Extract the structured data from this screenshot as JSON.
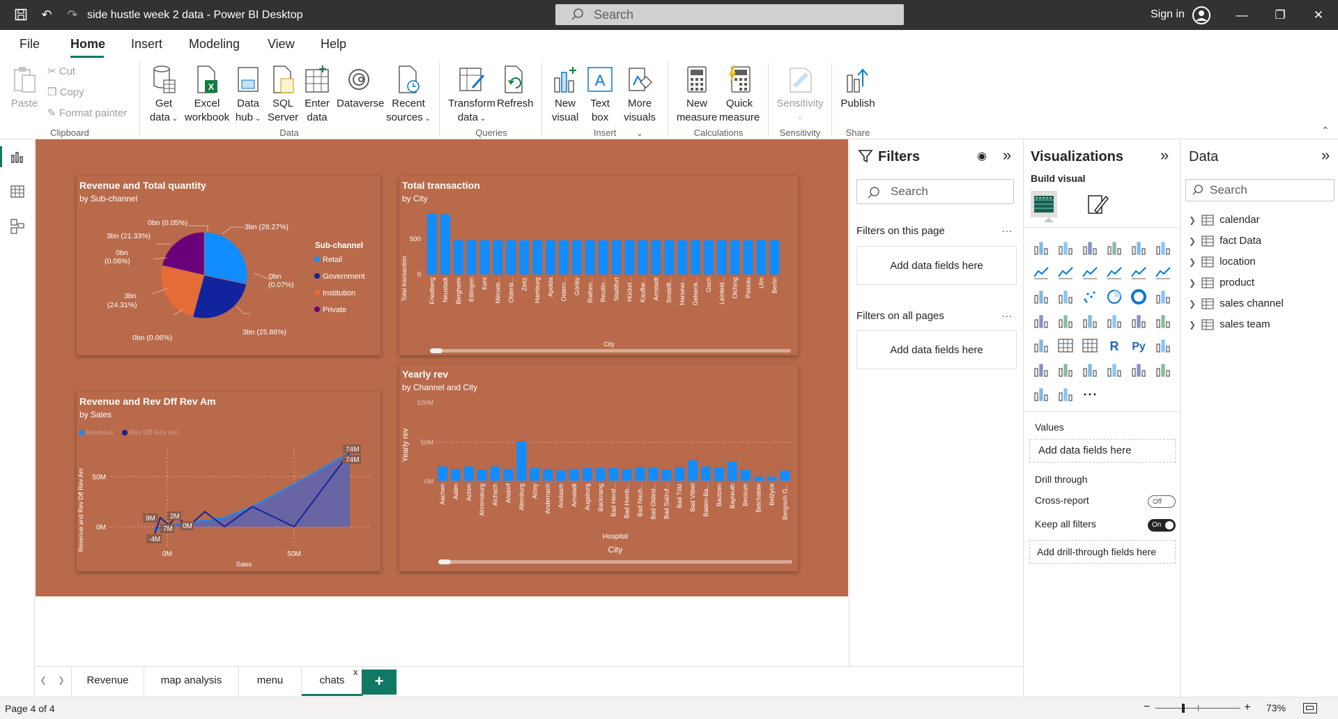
{
  "titlebar": {
    "doc_title": "side hustle week 2 data - Power BI Desktop",
    "search": "Search",
    "signin": "Sign in"
  },
  "menu": {
    "file": "File",
    "home": "Home",
    "insert": "Insert",
    "modeling": "Modeling",
    "view": "View",
    "help": "Help"
  },
  "ribbon": {
    "paste": "Paste",
    "cut": "Cut",
    "copy": "Copy",
    "format_painter": "Format painter",
    "clipboard": "Clipboard",
    "get_data_1": "Get",
    "get_data_2": "data",
    "excel_1": "Excel",
    "excel_2": "workbook",
    "hub_1": "Data",
    "hub_2": "hub",
    "sql_1": "SQL",
    "sql_2": "Server",
    "enter_1": "Enter",
    "enter_2": "data",
    "dataverse": "Dataverse",
    "recent_1": "Recent",
    "recent_2": "sources",
    "data_group": "Data",
    "transform_1": "Transform",
    "transform_2": "data",
    "refresh": "Refresh",
    "queries": "Queries",
    "newvis_1": "New",
    "newvis_2": "visual",
    "textbox_1": "Text",
    "textbox_2": "box",
    "morevis_1": "More",
    "morevis_2": "visuals",
    "insert_group": "Insert",
    "newmeasure_1": "New",
    "newmeasure_2": "measure",
    "quick_1": "Quick",
    "quick_2": "measure",
    "calc_group": "Calculations",
    "sensitivity": "Sensitivity",
    "sensitivity_group": "Sensitivity",
    "publish": "Publish",
    "share": "Share"
  },
  "pie_card": {
    "title": "Revenue and Total quantity",
    "subtitle": "by Sub-channel",
    "legend_title": "Sub-channel",
    "labels": [
      "0bn (0.05%)",
      "3bn (28.27%)",
      "3bn (21.33%)",
      "0bn",
      "(0.06%)",
      "0bn",
      "(0.07%)",
      "3bn",
      "(24.31%)",
      "0bn (0.06%)",
      "3bn (25.86%)"
    ]
  },
  "bar_card": {
    "title": "Total transaction",
    "subtitle": "by City",
    "ylabel": "Total transaction",
    "xlabel": "City",
    "ticks": [
      "500",
      "0"
    ]
  },
  "line_card": {
    "title": "Revenue and Rev Dff Rev Am",
    "subtitle": "by Sales",
    "ylabel": "Revenue and Rev Dff Rev Am",
    "xlabel": "Sales",
    "legend": [
      "Revenue",
      "Rev Dff Rev Am"
    ],
    "yticks": [
      "50M",
      "0M"
    ],
    "xticks": [
      "0M",
      "50M"
    ],
    "annot": [
      "74M",
      "74M",
      "9M",
      "2M",
      "7M",
      "0M",
      "-4M"
    ]
  },
  "yearly_card": {
    "title": "Yearly rev",
    "subtitle": "by Channel and City",
    "ylabel": "Yearly rev",
    "xlabel": "City",
    "group_label": "Hospital",
    "yticks": [
      "100M",
      "50M",
      "0M"
    ]
  },
  "chart_data": [
    {
      "type": "pie",
      "title": "Revenue and Total quantity",
      "subtitle": "by Sub-channel",
      "legend_title": "Sub-channel",
      "categories": [
        "Retail",
        "Government",
        "Institution",
        "Private"
      ],
      "values": [
        28.27,
        25.86,
        24.31,
        21.33
      ],
      "colors": [
        "#118DFF",
        "#12239E",
        "#E66C37",
        "#6B007B"
      ]
    },
    {
      "type": "bar",
      "title": "Total transaction",
      "subtitle": "by City",
      "xlabel": "City",
      "ylabel": "Total transaction",
      "ylim": [
        0,
        750
      ],
      "categories": [
        "Friedberg",
        "Neustadt",
        "Bergheim",
        "Ettlingen",
        "Kehl",
        "Merseb...",
        "Oldenb...",
        "Zeitz",
        "Hamburg",
        "Apolda",
        "Ostern...",
        "Görlitz",
        "Rathen...",
        "Reutlin...",
        "Stadtfurt",
        "Hückel...",
        "Kaufbe...",
        "Arnstadt",
        "Sindelfi...",
        "Harsewi...",
        "Gelsenk...",
        "Goch",
        "Leinfeld...",
        "Olching",
        "Passau",
        "Ulm",
        "Berlin"
      ],
      "values": [
        730,
        720,
        410,
        410,
        410,
        410,
        410,
        410,
        410,
        410,
        410,
        410,
        410,
        410,
        410,
        410,
        410,
        410,
        410,
        410,
        410,
        410,
        410,
        410,
        410,
        410,
        410
      ]
    },
    {
      "type": "line",
      "title": "Revenue and Rev Dff Rev Am",
      "subtitle": "by Sales",
      "xlabel": "Sales",
      "ylabel": "Revenue and Rev Dff Rev Am",
      "series": [
        {
          "name": "Revenue",
          "x": [
            0,
            1,
            5,
            15,
            25,
            35,
            45,
            55,
            70
          ],
          "y": [
            -4,
            -3,
            2,
            5,
            9,
            20,
            35,
            50,
            74
          ]
        },
        {
          "name": "Rev Dff Rev Am",
          "x": [
            0,
            2,
            5,
            8,
            12,
            18,
            25,
            35,
            50,
            70
          ],
          "y": [
            -7,
            9,
            2,
            10,
            0,
            15,
            0,
            20,
            0,
            74
          ]
        }
      ]
    },
    {
      "type": "bar",
      "title": "Yearly rev",
      "subtitle": "by Channel and City",
      "xlabel": "City",
      "ylabel": "Yearly rev",
      "ylim": [
        0,
        100
      ],
      "group": "Hospital",
      "categories": [
        "Aachen",
        "Aalen",
        "Achim",
        "Ahrensburg",
        "Aichach",
        "Alsdorf",
        "Altenburg",
        "Alzey",
        "Andernach",
        "Ansbach",
        "Arnstadt",
        "Augsburg",
        "Backnang",
        "Bad Hersf...",
        "Bad Homb...",
        "Bad Nauh...",
        "Bad Oldesl...",
        "Bad Salzuf...",
        "Bad Tölz",
        "Bad Vilbel",
        "Baden-Ba...",
        "Bautzen",
        "Bayreuth",
        "Beckum",
        "Belchatow",
        "Bełżyce",
        "Bergisch G..."
      ],
      "values": [
        18,
        15,
        18,
        14,
        18,
        15,
        50,
        16,
        15,
        13,
        15,
        16,
        16,
        16,
        15,
        17,
        17,
        14,
        17,
        26,
        18,
        17,
        24,
        14,
        5,
        5,
        13
      ]
    }
  ],
  "filters": {
    "title": "Filters",
    "search": "Search",
    "on_page": "Filters on this page",
    "on_all": "Filters on all pages",
    "add": "Add data fields here",
    "add2": "Add data fields here",
    "dots": "…"
  },
  "viz": {
    "title": "Visualizations",
    "build": "Build visual",
    "values": "Values",
    "add_values": "Add data fields here",
    "drill": "Drill through",
    "cross": "Cross-report",
    "cross_state": "Off",
    "keep": "Keep all filters",
    "keep_state": "On",
    "add_drill": "Add drill-through fields here"
  },
  "data": {
    "title": "Data",
    "search": "Search",
    "tables": [
      "calendar",
      "fact Data",
      "location",
      "product",
      "sales channel",
      "sales team"
    ]
  },
  "pages": {
    "tabs": [
      "Revenue",
      "map analysis",
      "menu",
      "chats"
    ],
    "close": "x",
    "add": "+"
  },
  "status": {
    "page": "Page 4 of 4",
    "zoom": "73%"
  },
  "colors": {
    "accent": "#117865",
    "page_bg": "#b96a4a",
    "bar": "#118DFF"
  }
}
